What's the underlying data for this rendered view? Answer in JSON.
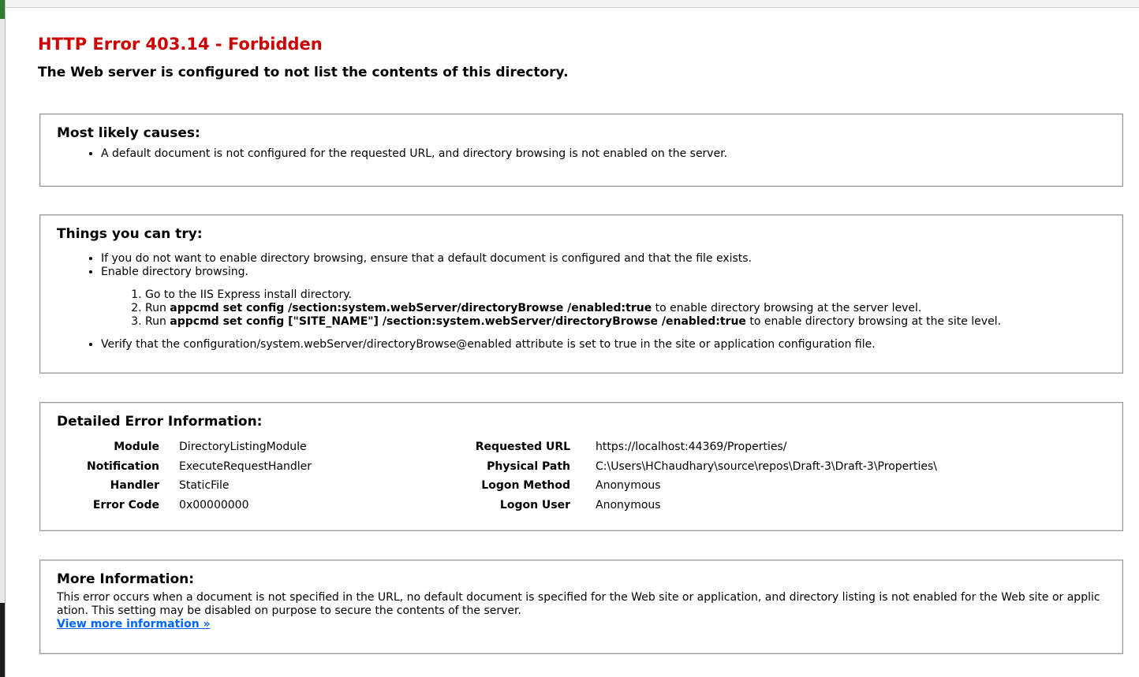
{
  "title": "HTTP Error 403.14 - Forbidden",
  "subtitle": "The Web server is configured to not list the contents of this directory.",
  "causes": {
    "heading": "Most likely causes:",
    "items": [
      "A default document is not configured for the requested URL, and directory browsing is not enabled on the server."
    ]
  },
  "try": {
    "heading": "Things you can try:",
    "item1": "If you do not want to enable directory browsing, ensure that a default document is configured and that the file exists.",
    "item2": "Enable directory browsing.",
    "step1": "Go to the IIS Express install directory.",
    "step2_pre": "Run ",
    "step2_cmd": "appcmd set config /section:system.webServer/directoryBrowse /enabled:true",
    "step2_post": " to enable directory browsing at the server level.",
    "step3_pre": "Run ",
    "step3_cmd": "appcmd set config [\"SITE_NAME\"] /section:system.webServer/directoryBrowse /enabled:true",
    "step3_post": " to enable directory browsing at the site level.",
    "item3": "Verify that the configuration/system.webServer/directoryBrowse@enabled attribute is set to true in the site or application configuration file."
  },
  "details": {
    "heading": "Detailed Error Information:",
    "rows": [
      {
        "l": "Module",
        "v": "DirectoryListingModule",
        "rl": "Requested URL",
        "rv": "https://localhost:44369/Properties/"
      },
      {
        "l": "Notification",
        "v": "ExecuteRequestHandler",
        "rl": "Physical Path",
        "rv": "C:\\Users\\HChaudhary\\source\\repos\\Draft-3\\Draft-3\\Properties\\"
      },
      {
        "l": "Handler",
        "v": "StaticFile",
        "rl": "Logon Method",
        "rv": "Anonymous"
      },
      {
        "l": "Error Code",
        "v": "0x00000000",
        "rl": "Logon User",
        "rv": "Anonymous"
      }
    ]
  },
  "more": {
    "heading": "More Information:",
    "text": "This error occurs when a document is not specified in the URL, no default document is specified for the Web site or application, and directory listing is not enabled for the Web site or applic ation. This setting may be disabled on purpose to secure the contents of the server.",
    "link": "View more information »"
  }
}
